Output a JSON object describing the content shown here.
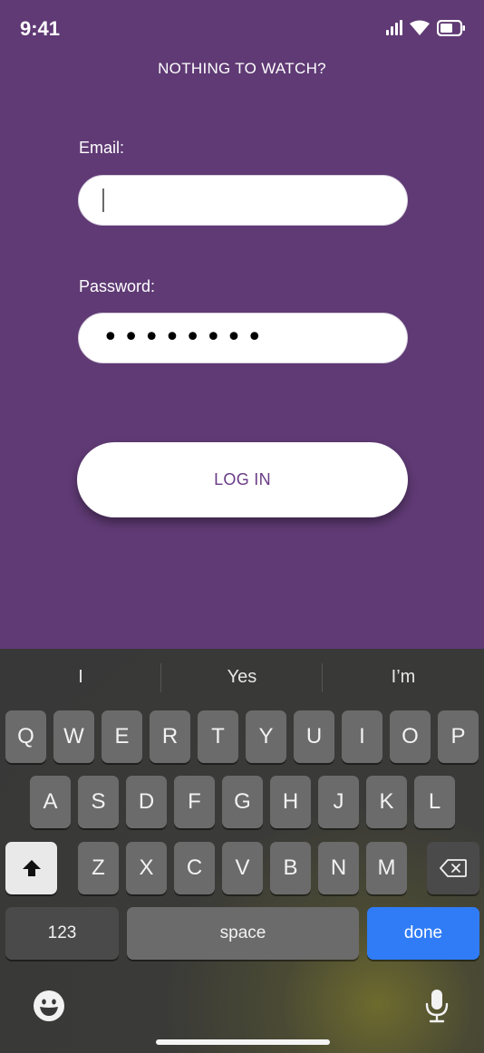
{
  "status_bar": {
    "time": "9:41"
  },
  "header": {
    "title": "NOTHING TO WATCH?"
  },
  "form": {
    "email_label": "Email:",
    "email_value": "",
    "password_label": "Password:",
    "password_value": "••••••••",
    "login_label": "LOG IN"
  },
  "colors": {
    "background": "#5f3a74",
    "button_text": "#6a3a86",
    "done_key": "#2f7cf6"
  },
  "keyboard": {
    "suggestions": [
      "I",
      "Yes",
      "I’m"
    ],
    "row1": [
      "Q",
      "W",
      "E",
      "R",
      "T",
      "Y",
      "U",
      "I",
      "O",
      "P"
    ],
    "row2": [
      "A",
      "S",
      "D",
      "F",
      "G",
      "H",
      "J",
      "K",
      "L"
    ],
    "row3": [
      "Z",
      "X",
      "C",
      "V",
      "B",
      "N",
      "M"
    ],
    "numbers_label": "123",
    "space_label": "space",
    "done_label": "done"
  }
}
